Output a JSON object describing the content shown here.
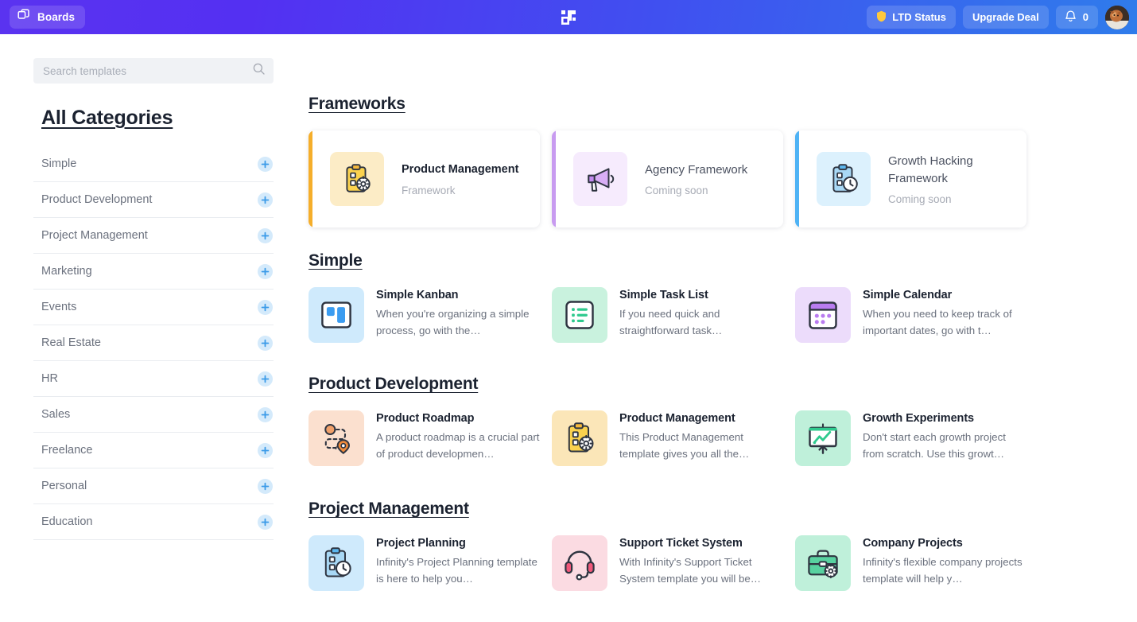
{
  "header": {
    "boards_label": "Boards",
    "boards_icon": "copy-boards-icon",
    "logo_icon": "infinity-logo",
    "ltd_status_label": "LTD Status",
    "ltd_status_icon": "shield-icon",
    "upgrade_label": "Upgrade Deal",
    "bell_icon": "bell-icon",
    "notification_count": "0",
    "avatar_icon": "user-avatar",
    "gradient_from": "#5a33f0",
    "gradient_to": "#2f7ceb"
  },
  "sidebar": {
    "search": {
      "placeholder": "Search templates",
      "value": "",
      "icon": "search-icon"
    },
    "heading": "All Categories",
    "add_icon": "plus-icon",
    "items": [
      {
        "label": "Simple"
      },
      {
        "label": "Product Development"
      },
      {
        "label": "Project Management"
      },
      {
        "label": "Marketing"
      },
      {
        "label": "Events"
      },
      {
        "label": "Real Estate"
      },
      {
        "label": "HR"
      },
      {
        "label": "Sales"
      },
      {
        "label": "Freelance"
      },
      {
        "label": "Personal"
      },
      {
        "label": "Education"
      }
    ]
  },
  "main": {
    "sections": [
      {
        "title": "Frameworks",
        "type": "framework",
        "cards": [
          {
            "title": "Product Management",
            "subtitle": "Framework",
            "icon": "clipboard-gear-icon",
            "accent": "#f5ae2b",
            "icon_bg": "#fcecc6",
            "available": true
          },
          {
            "title": "Agency Framework",
            "subtitle": "Coming soon",
            "icon": "megaphone-icon",
            "accent": "#c89bf0",
            "icon_bg": "#f6ebfd",
            "available": false
          },
          {
            "title": "Growth Hacking Framework",
            "subtitle": "Coming soon",
            "icon": "clipboard-clock-icon",
            "accent": "#4fb3f5",
            "icon_bg": "#dcf1fd",
            "available": false
          }
        ]
      },
      {
        "title": "Simple",
        "type": "template",
        "cards": [
          {
            "title": "Simple Kanban",
            "desc": "When you're organizing a simple process, go with the…",
            "icon": "kanban-board-icon",
            "icon_bg": "#cfeafc"
          },
          {
            "title": "Simple Task List",
            "desc": "If you need quick and straightforward task…",
            "icon": "task-list-icon",
            "icon_bg": "#c9f2de"
          },
          {
            "title": "Simple Calendar",
            "desc": "When you need to keep track of important dates, go with t…",
            "icon": "calendar-icon",
            "icon_bg": "#ecdcfb"
          }
        ]
      },
      {
        "title": "Product Development",
        "type": "template",
        "cards": [
          {
            "title": "Product Roadmap",
            "desc": "A product roadmap is a crucial part of product developmen…",
            "icon": "roadmap-pin-icon",
            "icon_bg": "#fbe0cf"
          },
          {
            "title": "Product Management",
            "desc": "This Product Management template gives you all the…",
            "icon": "clipboard-gear-icon",
            "icon_bg": "#fbe6b8"
          },
          {
            "title": "Growth Experiments",
            "desc": "Don't start each growth project from scratch. Use this growt…",
            "icon": "growth-chart-icon",
            "icon_bg": "#bff0da"
          }
        ]
      },
      {
        "title": "Project Management",
        "type": "template",
        "cards": [
          {
            "title": "Project Planning",
            "desc": "Infinity's Project Planning template is here to help you…",
            "icon": "clipboard-clock-icon",
            "icon_bg": "#cfeafc"
          },
          {
            "title": "Support Ticket System",
            "desc": "With Infinity's Support Ticket System template you will be…",
            "icon": "headset-icon",
            "icon_bg": "#fbdbe2"
          },
          {
            "title": "Company Projects",
            "desc": "Infinity's flexible company projects template will help y…",
            "icon": "briefcase-gear-icon",
            "icon_bg": "#bff0da"
          }
        ]
      }
    ]
  }
}
